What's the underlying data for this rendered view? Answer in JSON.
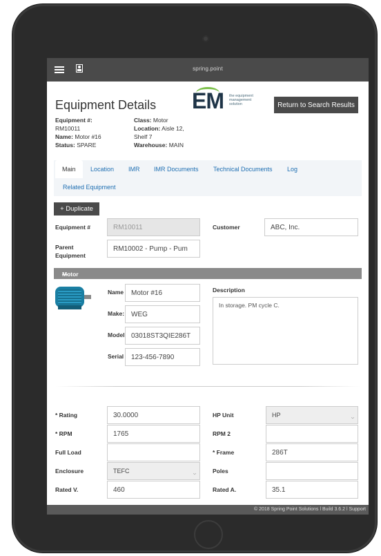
{
  "app": {
    "brand": "spring.point"
  },
  "header": {
    "title": "Equipment Details",
    "logo_text": "EM",
    "logo_sub": [
      "the equipment",
      "management",
      "solution"
    ],
    "return_label": "Return to Search Results"
  },
  "summary": {
    "equipment_label": "Equipment #:",
    "equipment_value": "RM10011",
    "name_label": "Name:",
    "name_value": "Motor #16",
    "status_label": "Status:",
    "status_value": "SPARE",
    "class_label": "Class:",
    "class_value": "Motor",
    "location_label": "Location:",
    "location_value": "Aisle 12,",
    "location_value2": "Shelf 7",
    "warehouse_label": "Warehouse:",
    "warehouse_value": "MAIN"
  },
  "tabs": [
    "Main",
    "Location",
    "IMR",
    "IMR Documents",
    "Technical Documents",
    "Log",
    "Related Equipment"
  ],
  "form": {
    "duplicate_label": "+ Duplicate",
    "equipment_no_label": "Equipment #",
    "equipment_no_value": "RM10011",
    "customer_label": "Customer",
    "customer_value": "ABC, Inc.",
    "parent_label1": "Parent",
    "parent_label2": "Equipment",
    "parent_value": "RM10002 - Pump - Pum"
  },
  "motor": {
    "section_title": "Motor",
    "name_label": "Name",
    "name_value": "Motor #16",
    "make_label": "Make:",
    "make_value": "WEG",
    "model_label": "Model",
    "model_value": "03018ST3QIE286T",
    "serial_label": "Serial",
    "serial_value": "123-456-7890",
    "description_label": "Description",
    "description_value": "In storage. PM cycle C."
  },
  "specs": {
    "rating_label": "* Rating",
    "rating_value": "30.0000",
    "hp_unit_label": "HP Unit",
    "hp_unit_value": "HP",
    "rpm_label": "* RPM",
    "rpm_value": "1765",
    "rpm2_label": "RPM 2",
    "rpm2_value": "",
    "full_load_label": "Full Load",
    "full_load_value": "",
    "frame_label": "* Frame",
    "frame_value": "286T",
    "enclosure_label": "Enclosure",
    "enclosure_value": "TEFC",
    "poles_label": "Poles",
    "poles_value": "",
    "rated_v_label": "Rated V.",
    "rated_v_value": "460",
    "rated_a_label": "Rated A.",
    "rated_a_value": "35.1"
  },
  "footer": {
    "text": "© 2018 Spring Point Solutions  l Build 3.6.2 l Support"
  },
  "colors": {
    "topbar": "#4a4a4a",
    "link": "#1f6fb2",
    "section": "#8a8a8a",
    "logo_green": "#7cc04a",
    "logo_navy": "#1e3447"
  },
  "icons": {
    "menu": "hamburger-icon",
    "user": "user-icon"
  }
}
